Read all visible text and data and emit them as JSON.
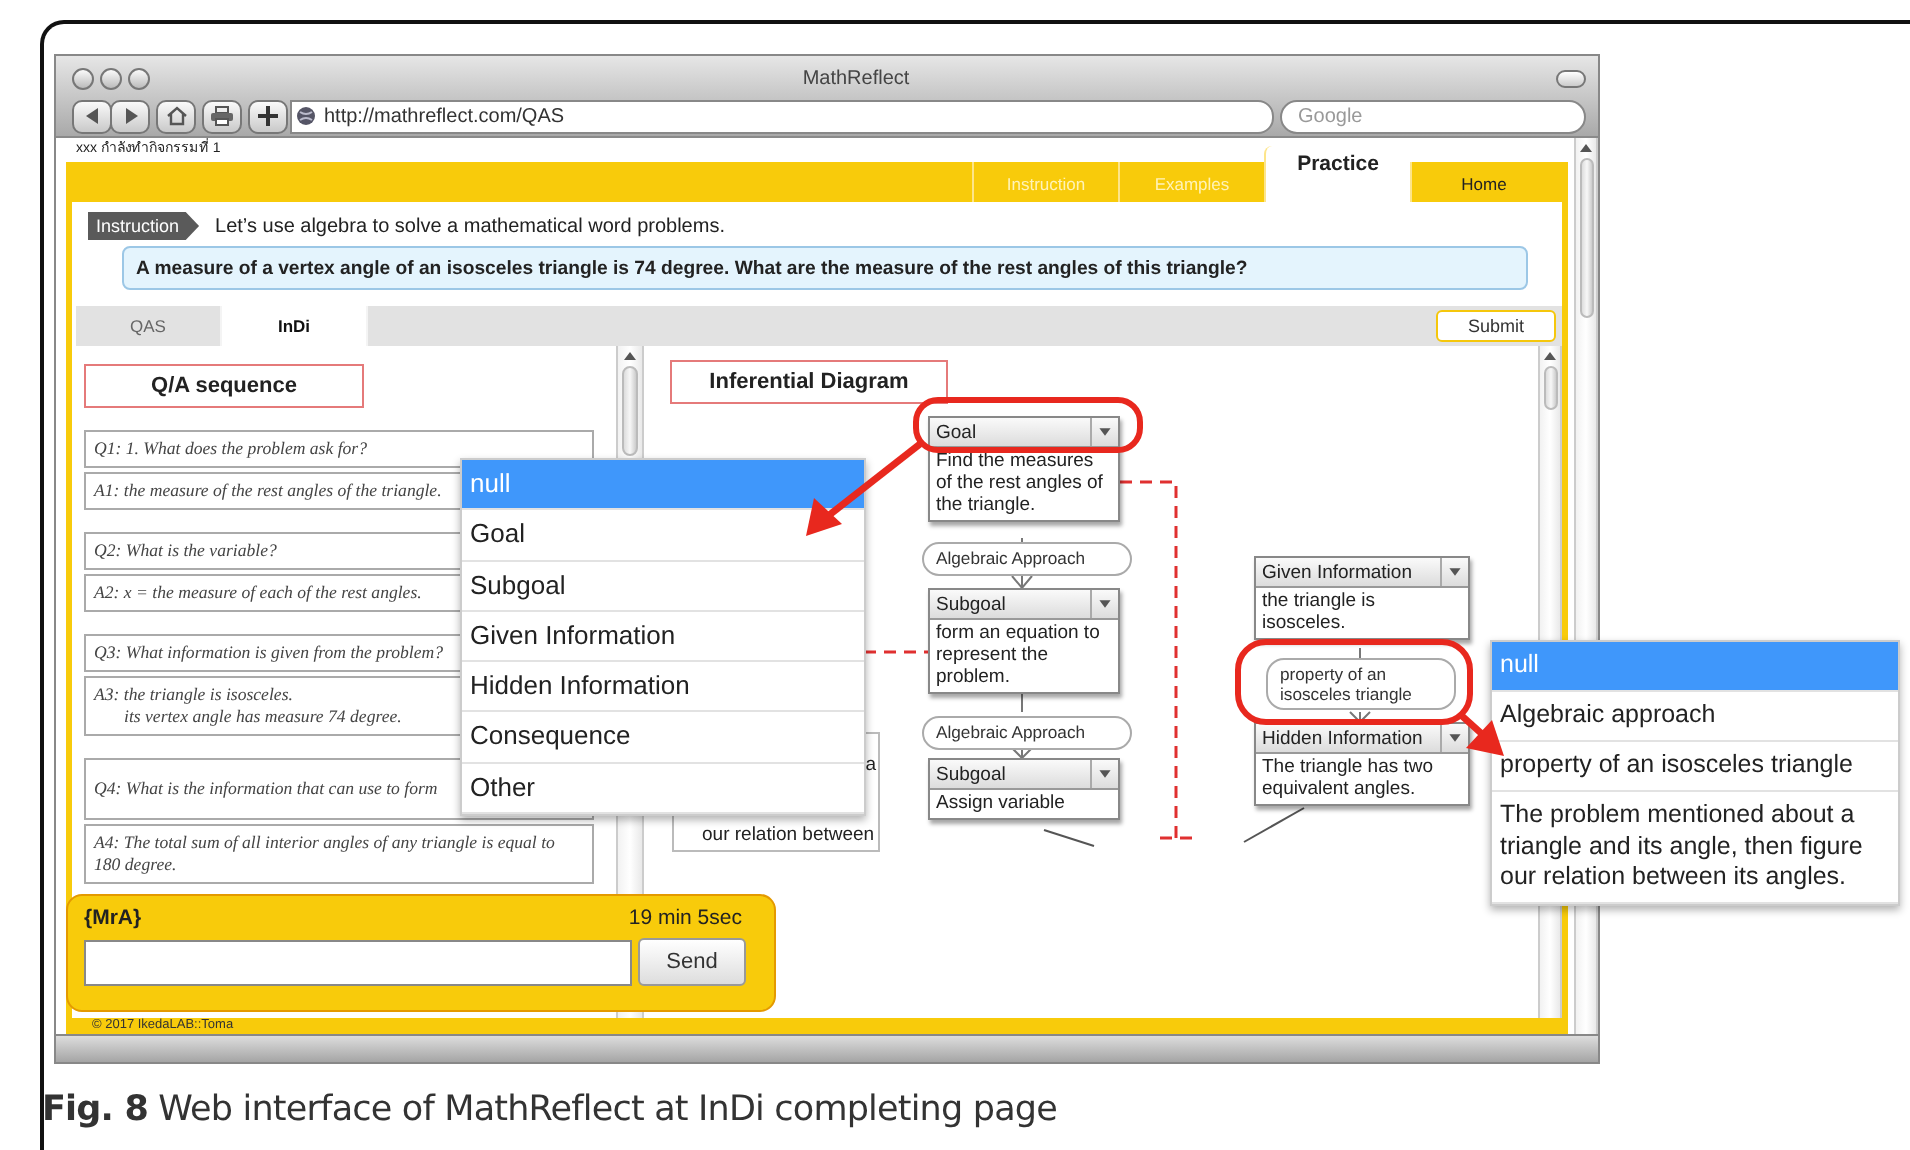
{
  "browser": {
    "title": "MathReflect",
    "url": "http://mathreflect.com/QAS",
    "search": {
      "placeholder": "Google"
    }
  },
  "status_text": "xxx กำลังทำกิจกรรมที่ 1",
  "nav_tabs": [
    {
      "label": "Instruction",
      "selected": false,
      "disabled": true
    },
    {
      "label": "Examples",
      "selected": false,
      "disabled": true
    },
    {
      "label": "Practice",
      "selected": true,
      "disabled": false
    },
    {
      "label": "Home",
      "selected": false,
      "disabled": false
    }
  ],
  "instruction": {
    "label": "Instruction",
    "text": "Let’s use algebra to solve a mathematical word problems."
  },
  "problem": "A measure of a vertex angle of an isosceles triangle is 74 degree. What are the measure of the rest angles of this triangle?",
  "view_tabs": [
    {
      "label": "QAS",
      "selected": false
    },
    {
      "label": "InDi",
      "selected": true
    }
  ],
  "submit": "Submit",
  "qa": {
    "title": "Q/A sequence",
    "pairs": [
      {
        "q": "Q1: 1. What does the problem ask for?",
        "a": [
          "A1: the measure of the rest angles of the triangle."
        ]
      },
      {
        "q": "Q2: What is the variable?",
        "a": [
          "A2: x = the measure of each of the rest angles."
        ]
      },
      {
        "q": "Q3: What information is given from the problem?",
        "a": [
          "A3: the triangle is isosceles.",
          "its vertex angle has measure 74 degree."
        ]
      },
      {
        "q": "Q4: What is the information that can use to form",
        "a": [
          "A4: The total sum of all interior angles of any triangle is equal to 180 degree."
        ]
      }
    ]
  },
  "diagram": {
    "title": "Inferential Diagram",
    "nodes": [
      {
        "type": "Goal",
        "text": "Find the measures of the rest angles of the triangle."
      },
      {
        "type": "Subgoal",
        "text": "form an equation to represent the problem."
      },
      {
        "type": "Subgoal",
        "text": "Assign variable"
      },
      {
        "type": "Given Information",
        "text": "the triangle is isosceles."
      },
      {
        "type": "Hidden Information",
        "text": "The triangle has two equivalent angles."
      }
    ],
    "links": [
      "Algebraic Approach",
      "Algebraic Approach",
      "property of an isosceles triangle"
    ],
    "partial_node": {
      "line_1": "a",
      "line_2": "our relation between"
    }
  },
  "type_menu": {
    "items": [
      {
        "label": "null",
        "selected": true
      },
      {
        "label": "Goal",
        "selected": false
      },
      {
        "label": "Subgoal",
        "selected": false
      },
      {
        "label": "Given Information",
        "selected": false
      },
      {
        "label": "Hidden Information",
        "selected": false
      },
      {
        "label": "Consequence",
        "selected": false
      },
      {
        "label": "Other",
        "selected": false
      }
    ]
  },
  "link_menu": {
    "items": [
      {
        "label": "null",
        "selected": true
      },
      {
        "label": "Algebraic approach",
        "selected": false
      },
      {
        "label": "property of an isosceles triangle",
        "selected": false
      },
      {
        "label": "The problem mentioned about a triangle and its angle, then figure our relation between its angles.",
        "selected": false
      }
    ]
  },
  "chat": {
    "user": "{MrA}",
    "timer": "19 min 5sec",
    "send": "Send"
  },
  "footer": "© 2017 IkedaLAB::Toma",
  "caption": "**Fig. 8** Web interface of MathReflect at InDi completing page"
}
